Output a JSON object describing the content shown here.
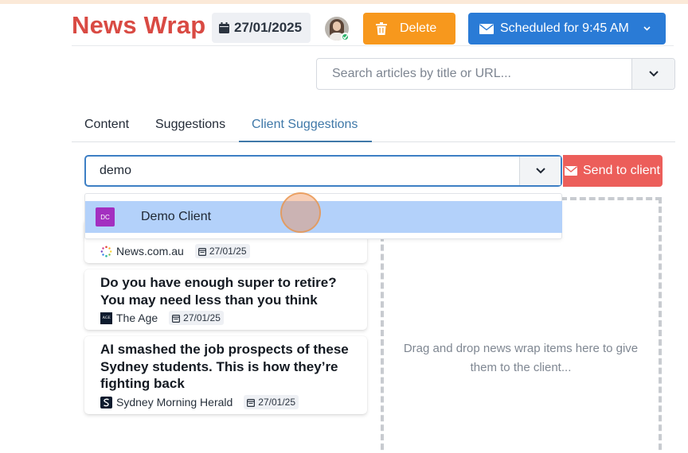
{
  "header": {
    "app_title": "News Wrap",
    "date": "27/01/2025",
    "delete_label": "Delete",
    "scheduled_label": "Scheduled for 9:45 AM"
  },
  "search": {
    "placeholder": "Search articles by title or URL...",
    "value": ""
  },
  "tabs": [
    {
      "label": "Content",
      "active": false
    },
    {
      "label": "Suggestions",
      "active": false
    },
    {
      "label": "Client Suggestions",
      "active": true
    }
  ],
  "client_select": {
    "value": "demo",
    "send_label": "Send to client"
  },
  "dropdown": {
    "options": [
      {
        "initials": "DC",
        "label": "Demo Client",
        "highlighted": true
      }
    ]
  },
  "articles": [
    {
      "title": "",
      "source": "News.com.au",
      "source_icon": "newscomau-logo-icon",
      "date": "27/01/25"
    },
    {
      "title": "Do you have enough super to retire? You may need less than you think",
      "source": "The Age",
      "source_icon": "the-age-logo-icon",
      "date": "27/01/25"
    },
    {
      "title": "AI smashed the job prospects of these Sydney students. This is how they’re fighting back",
      "source": "Sydney Morning Herald",
      "source_icon": "smh-logo-icon",
      "date": "27/01/25"
    }
  ],
  "dropzone": {
    "text": "Drag and drop news wrap items here to give them to the client..."
  },
  "colors": {
    "brand": "#d94a43",
    "delete": "#f7981d",
    "scheduled": "#2a7bd6",
    "send": "#ec5e5a",
    "active_tab": "#3f78a8",
    "option_highlight": "#b3d1fa",
    "client_avatar": "#a32fc0"
  }
}
